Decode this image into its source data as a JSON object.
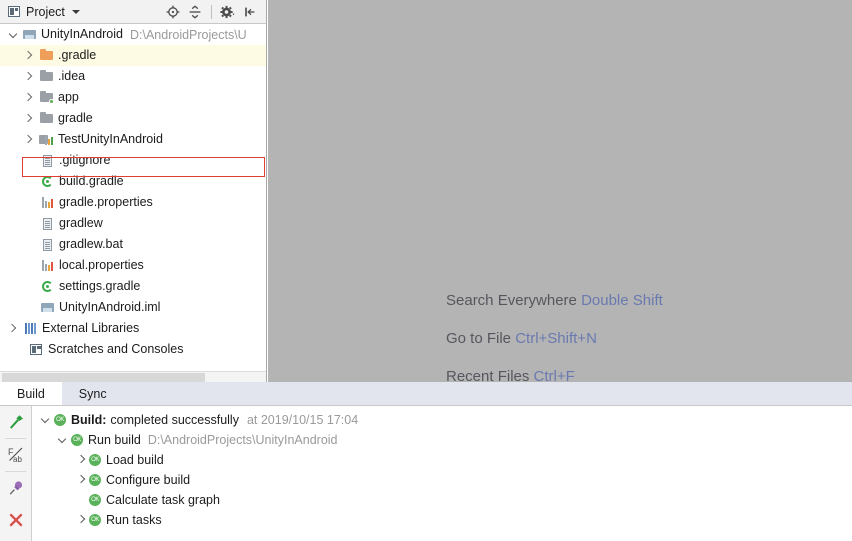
{
  "project_panel": {
    "toolbar": {
      "title": "Project",
      "project_icon": "project-window-icon",
      "caret_icon": "chevron-down-icon",
      "buttons": [
        {
          "name": "locate-icon",
          "title": "Select Opened File"
        },
        {
          "name": "collapse-all-icon",
          "title": "Collapse All"
        },
        {
          "name": "gear-icon",
          "title": "Settings"
        },
        {
          "name": "hide-panel-icon",
          "title": "Hide"
        }
      ]
    },
    "root": {
      "label": "UnityInAndroid",
      "path": "D:\\AndroidProjects\\U",
      "icon": "module-icon",
      "expanded": true
    },
    "items": [
      {
        "label": ".gradle",
        "icon": "folder-orange-icon",
        "indent": 1,
        "arrow": true,
        "highlight": true
      },
      {
        "label": ".idea",
        "icon": "folder-grey-icon",
        "indent": 1,
        "arrow": true,
        "highlight": false
      },
      {
        "label": "app",
        "icon": "folder-module-icon",
        "indent": 1,
        "arrow": true,
        "highlight": false
      },
      {
        "label": "gradle",
        "icon": "folder-grey-icon",
        "indent": 1,
        "arrow": true,
        "highlight": false
      },
      {
        "label": "TestUnityInAndroid",
        "icon": "module-properties-icon",
        "indent": 1,
        "arrow": true,
        "highlight": false,
        "selected": true
      },
      {
        "label": ".gitignore",
        "icon": "file-icon",
        "indent": 2,
        "arrow": false,
        "highlight": false
      },
      {
        "label": "build.gradle",
        "icon": "gradle-icon",
        "indent": 2,
        "arrow": false,
        "highlight": false
      },
      {
        "label": "gradle.properties",
        "icon": "properties-icon",
        "indent": 2,
        "arrow": false,
        "highlight": false
      },
      {
        "label": "gradlew",
        "icon": "file-icon",
        "indent": 2,
        "arrow": false,
        "highlight": false
      },
      {
        "label": "gradlew.bat",
        "icon": "file-icon",
        "indent": 2,
        "arrow": false,
        "highlight": false
      },
      {
        "label": "local.properties",
        "icon": "properties-icon",
        "indent": 2,
        "arrow": false,
        "highlight": false
      },
      {
        "label": "settings.gradle",
        "icon": "gradle-icon",
        "indent": 2,
        "arrow": false,
        "highlight": false
      },
      {
        "label": "UnityInAndroid.iml",
        "icon": "iml-icon",
        "indent": 2,
        "arrow": false,
        "highlight": false
      },
      {
        "label": "External Libraries",
        "icon": "libraries-icon",
        "indent": 0,
        "arrow": true,
        "highlight": false
      },
      {
        "label": "Scratches and Consoles",
        "icon": "scratches-icon",
        "indent": 0,
        "arrow": false,
        "highlight": false
      }
    ],
    "scrollbar": {
      "name": "tree-horizontal-scrollbar"
    }
  },
  "editor": {
    "hints": [
      {
        "text": "Search Everywhere ",
        "key": "Double Shift"
      },
      {
        "text": "Go to File ",
        "key": "Ctrl+Shift+N"
      },
      {
        "text": "Recent Files ",
        "key": "Ctrl+F"
      }
    ],
    "background_color": "#b4b4b4",
    "text_color": "#56565e",
    "key_color": "#6a7ab0"
  },
  "bottom_panel": {
    "tabs": [
      {
        "label": "Build",
        "active": true
      },
      {
        "label": "Sync",
        "active": false
      }
    ],
    "gutter_buttons": [
      {
        "name": "build-hammer-icon",
        "color": "#4a9b4a"
      },
      {
        "name": "soft-wrap-icon",
        "color": "#555555"
      },
      {
        "name": "pin-icon",
        "color": "#8a5fa8"
      },
      {
        "name": "close-icon",
        "color": "#d9534f"
      }
    ],
    "tree": [
      {
        "label": "Build:",
        "bold": true,
        "extra": "completed successfully",
        "dim": "at 2019/10/15 17:04",
        "indent": 0,
        "chevron": "down",
        "status": "ok"
      },
      {
        "label": "Run build",
        "bold": false,
        "extra": "",
        "dim": "",
        "path": "D:\\AndroidProjects\\UnityInAndroid",
        "indent": 1,
        "chevron": "down",
        "status": "ok"
      },
      {
        "label": "Load build",
        "bold": false,
        "extra": "",
        "dim": "",
        "indent": 2,
        "chevron": "right",
        "status": "ok"
      },
      {
        "label": "Configure build",
        "bold": false,
        "extra": "",
        "dim": "",
        "indent": 2,
        "chevron": "right",
        "status": "ok"
      },
      {
        "label": "Calculate task graph",
        "bold": false,
        "extra": "",
        "dim": "",
        "indent": 2,
        "chevron": "none",
        "status": "ok"
      },
      {
        "label": "Run tasks",
        "bold": false,
        "extra": "",
        "dim": "",
        "indent": 2,
        "chevron": "right",
        "status": "ok"
      }
    ]
  },
  "annotation": {
    "name": "red-highlight-box",
    "color": "#e03c31",
    "target": "TestUnityInAndroid"
  }
}
